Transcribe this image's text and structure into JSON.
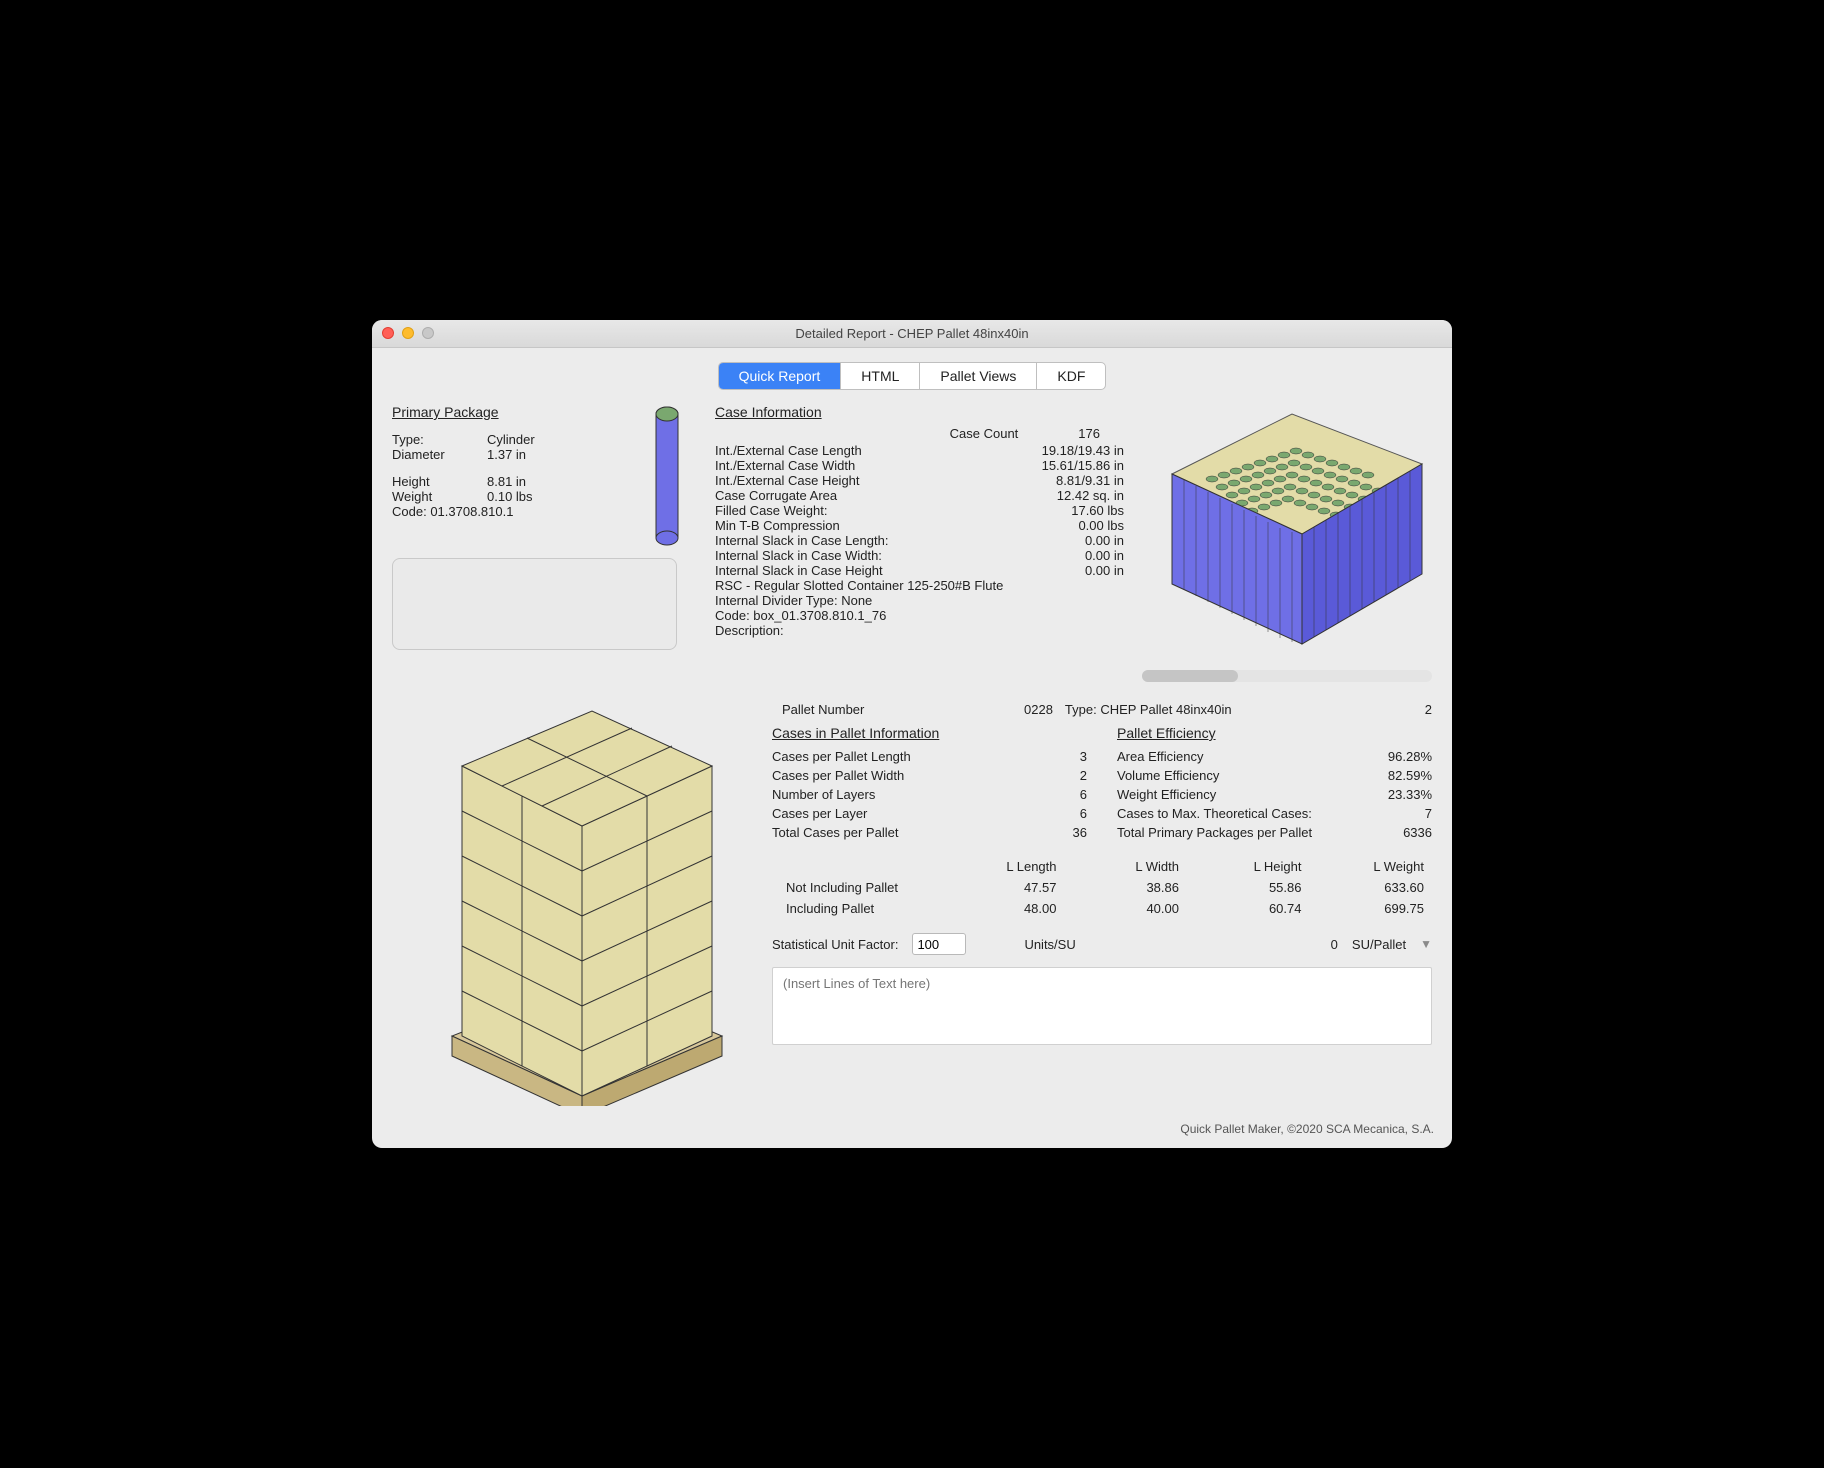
{
  "window": {
    "title": "Detailed Report - CHEP Pallet 48inx40in"
  },
  "tabs": {
    "t0": "Quick Report",
    "t1": "HTML",
    "t2": "Pallet Views",
    "t3": "KDF"
  },
  "primary": {
    "heading": "Primary Package",
    "type_label": "Type:",
    "type": "Cylinder",
    "diam_label": "Diameter",
    "diam": "1.37 in",
    "height_label": "Height",
    "height": "8.81 in",
    "weight_label": "Weight",
    "weight": "0.10 lbs",
    "code_label": "Code:",
    "code": "01.3708.810.1"
  },
  "case": {
    "heading": "Case Information",
    "count_label": "Case Count",
    "count": "176",
    "len_label": "Int./External Case Length",
    "len_val": "19.18/19.43 in",
    "wid_label": "Int./External Case Width",
    "wid_val": "15.61/15.86 in",
    "hei_label": "Int./External Case Height",
    "hei_val": "8.81/9.31 in",
    "corr_label": "Case Corrugate Area",
    "corr_val": "12.42 sq. in",
    "fw_label": "Filled Case Weight:",
    "fw_val": "17.60 lbs",
    "tb_label": "Min T-B Compression",
    "tb_val": "0.00 lbs",
    "sl_l_label": "Internal Slack in Case Length:",
    "sl_l_val": "0.00 in",
    "sl_w_label": "Internal Slack in Case Width:",
    "sl_w_val": "0.00 in",
    "sl_h_label": "Internal Slack in Case Height",
    "sl_h_val": "0.00 in",
    "rsc": "RSC - Regular Slotted Container 125-250#B Flute",
    "div": "Internal Divider Type: None",
    "code": "Code: box_01.3708.810.1_76",
    "desc_label": "Description:"
  },
  "pallet": {
    "num_label": "Pallet Number",
    "num": "0228",
    "type_label": "Type:",
    "type": "CHEP Pallet 48inx40in",
    "index": "2",
    "cases_heading": "Cases in Pallet Information",
    "eff_heading": "Pallet Efficiency",
    "cpl_label": "Cases per Pallet Length",
    "cpl": "3",
    "cpw_label": "Cases per Pallet Width",
    "cpw": "2",
    "nl_label": "Number of Layers",
    "nl": "6",
    "cplay_label": "Cases per Layer",
    "cplay": "6",
    "tc_label": "Total Cases per Pallet",
    "tc": "36",
    "ae_label": "Area Efficiency",
    "ae": "96.28%",
    "ve_label": "Volume Efficiency",
    "ve": "82.59%",
    "we_label": "Weight Efficiency",
    "we": "23.33%",
    "cmt_label": "Cases to Max. Theoretical Cases:",
    "cmt": "7",
    "tpp_label": "Total Primary Packages per Pallet",
    "tpp": "6336"
  },
  "dims": {
    "h_len": "L Length",
    "h_wid": "L Width",
    "h_hei": "L Height",
    "h_wgt": "L Weight",
    "row1_label": "Not Including Pallet",
    "r1_len": "47.57",
    "r1_wid": "38.86",
    "r1_hei": "55.86",
    "r1_wgt": "633.60",
    "row2_label": "Including Pallet",
    "r2_len": "48.00",
    "r2_wid": "40.00",
    "r2_hei": "60.74",
    "r2_wgt": "699.75"
  },
  "su": {
    "label": "Statistical Unit Factor:",
    "value": "100",
    "units_label": "Units/SU",
    "sup_value": "0",
    "sup_label": "SU/Pallet"
  },
  "notes": {
    "placeholder": "(Insert Lines of Text here)"
  },
  "footer": {
    "text": "Quick Pallet Maker, ©2020 SCA Mecanica, S.A."
  }
}
